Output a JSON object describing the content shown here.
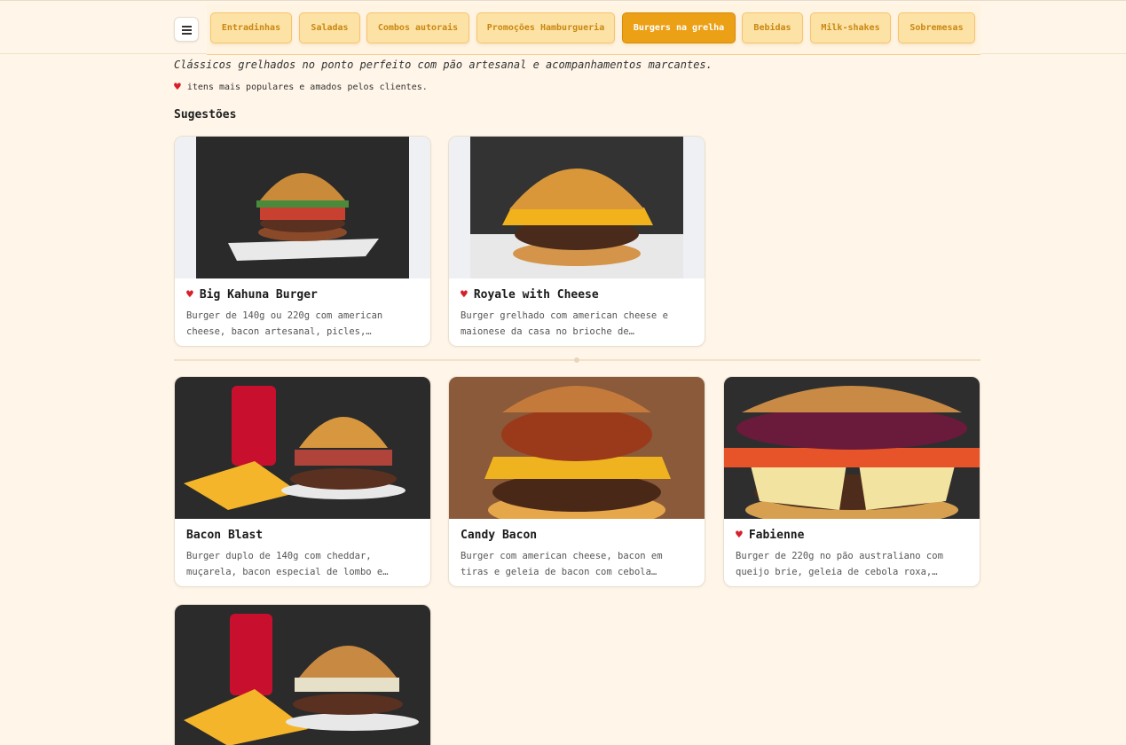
{
  "menu_icon": "hamburger-menu-icon",
  "categories": [
    {
      "label": "Entradinhas"
    },
    {
      "label": "Saladas"
    },
    {
      "label": "Combos autorais"
    },
    {
      "label": "Promoções Hamburgueria"
    },
    {
      "label": "Burgers na grelha"
    },
    {
      "label": "Bebidas"
    },
    {
      "label": "Milk-shakes"
    },
    {
      "label": "Sobremesas"
    }
  ],
  "active_category": "Burgers na grelha",
  "subtitle": "Clássicos grelhados no ponto perfeito com pão artesanal e acompanhamentos marcantes.",
  "popular_note": "itens mais populares e amados pelos clientes.",
  "suggestions_title": "Sugestões",
  "suggestions": [
    {
      "name": "Big Kahuna Burger",
      "desc": "Burger de 140g ou 220g com american cheese, bacon artesanal, picles,…",
      "popular": true
    },
    {
      "name": "Royale with Cheese",
      "desc": "Burger grelhado com american cheese e maionese da casa no brioche de…",
      "popular": true
    }
  ],
  "items": [
    {
      "name": "Bacon Blast",
      "desc": "Burger duplo de 140g com cheddar, muçarela, bacon especial de lombo e…",
      "popular": false
    },
    {
      "name": "Candy Bacon",
      "desc": "Burger com american cheese, bacon em tiras e geleia de bacon com cebola…",
      "popular": false
    },
    {
      "name": "Fabienne",
      "desc": "Burger de 220g no pão australiano com queijo brie, geleia de cebola roxa,…",
      "popular": true
    }
  ],
  "colors": {
    "accent": "#eba016",
    "chip": "#fde2a6",
    "background": "#fff6e9",
    "heart": "#d71f2c"
  }
}
